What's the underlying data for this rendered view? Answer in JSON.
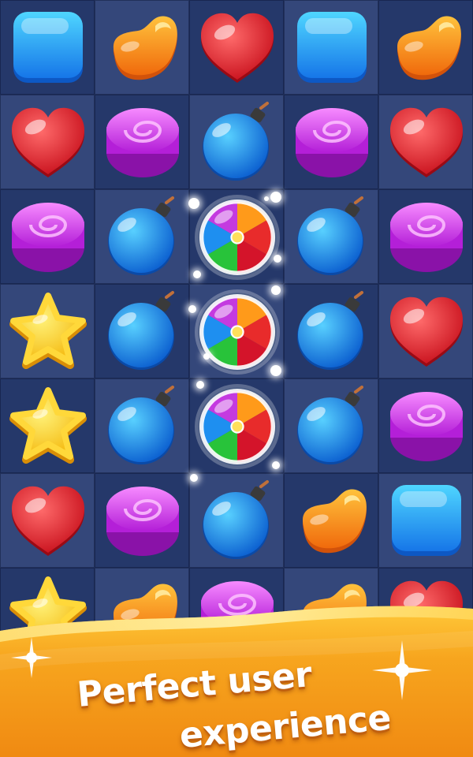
{
  "grid": [
    [
      "blue-square",
      "orange-jelly",
      "red-heart",
      "blue-square",
      "orange-jelly"
    ],
    [
      "red-heart",
      "purple-swirl",
      "blue-bomb",
      "purple-swirl",
      "red-heart"
    ],
    [
      "purple-swirl",
      "blue-bomb",
      "rainbow-ball",
      "blue-bomb",
      "purple-swirl"
    ],
    [
      "yellow-star",
      "blue-bomb",
      "rainbow-ball",
      "blue-bomb",
      "red-heart"
    ],
    [
      "yellow-star",
      "blue-bomb",
      "rainbow-ball",
      "blue-bomb",
      "purple-swirl"
    ],
    [
      "red-heart",
      "purple-swirl",
      "blue-bomb",
      "orange-jelly",
      "blue-square"
    ],
    [
      "yellow-star",
      "orange-jelly",
      "purple-swirl",
      "orange-jelly",
      "red-heart"
    ]
  ],
  "banner": {
    "line1": "Perfect user",
    "line2": "experience"
  },
  "colors": {
    "board_light": "#34477a",
    "board_dark": "#25386a",
    "banner_orange": "#f5a21c",
    "banner_yellow": "#ffd23a"
  }
}
